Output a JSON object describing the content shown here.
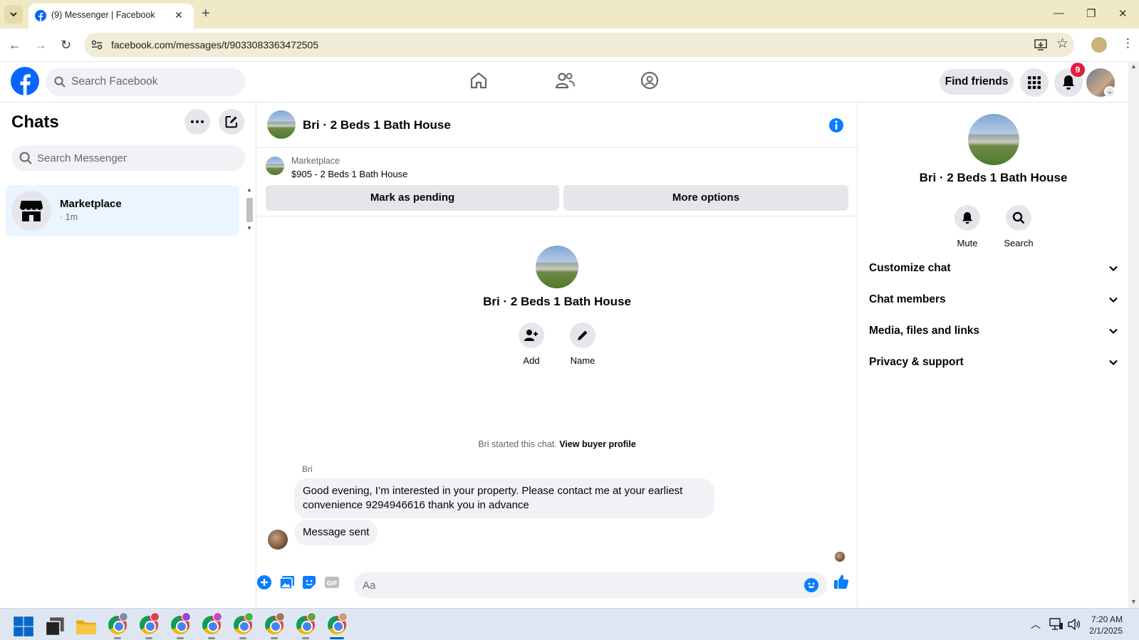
{
  "browser": {
    "tab_title": "(9) Messenger | Facebook",
    "url": "facebook.com/messages/t/9033083363472505"
  },
  "header": {
    "search_placeholder": "Search Facebook",
    "find_friends": "Find friends",
    "notification_count": "9"
  },
  "chats": {
    "title": "Chats",
    "search_placeholder": "Search Messenger",
    "items": [
      {
        "name": "Marketplace",
        "time": "· 1m"
      }
    ]
  },
  "conversation": {
    "title": "Bri · 2 Beds 1 Bath House",
    "marketplace_label": "Marketplace",
    "listing": "$905 - 2 Beds 1 Bath House",
    "mark_pending": "Mark as pending",
    "more_options": "More options",
    "intro_name": "Bri · 2 Beds 1 Bath House",
    "add_label": "Add",
    "name_label": "Name",
    "started_text": "Bri started this chat.",
    "view_buyer": "View buyer profile",
    "sender": "Bri",
    "messages": [
      "Good evening, I’m interested in your property. Please contact me at your earliest convenience 9294946616 thank you in advance",
      "Message sent"
    ],
    "composer_placeholder": "Aa"
  },
  "info_panel": {
    "name": "Bri · 2 Beds 1 Bath House",
    "mute": "Mute",
    "search": "Search",
    "sections": [
      "Customize chat",
      "Chat members",
      "Media, files and links",
      "Privacy & support"
    ]
  },
  "taskbar": {
    "time": "7:20 AM",
    "date": "2/1/2025"
  },
  "colors": {
    "facebook_blue": "#0866ff",
    "messenger_blue": "#0a7cff",
    "notification_red": "#e41e3f"
  }
}
